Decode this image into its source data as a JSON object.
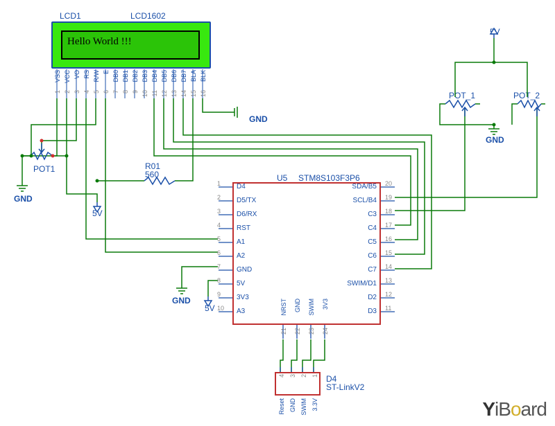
{
  "lcd": {
    "ref": "LCD1",
    "model": "LCD1602",
    "display_text": "Hello World !!!",
    "pins": [
      "VSS",
      "VCC",
      "VO",
      "RS",
      "R/W",
      "E",
      "DB0",
      "DB1",
      "DB2",
      "DB3",
      "DB4",
      "DB5",
      "DB6",
      "DB7",
      "BLA",
      "BLK"
    ],
    "pin_nums": [
      "1",
      "2",
      "3",
      "4",
      "5",
      "6",
      "7",
      "8",
      "9",
      "10",
      "11",
      "12",
      "13",
      "14",
      "15",
      "16"
    ]
  },
  "mcu": {
    "ref": "U5",
    "part": "STM8S103F3P6",
    "left_pins": [
      {
        "num": "1",
        "name": "D4"
      },
      {
        "num": "2",
        "name": "D5/TX"
      },
      {
        "num": "3",
        "name": "D6/RX"
      },
      {
        "num": "4",
        "name": "RST"
      },
      {
        "num": "5",
        "name": "A1"
      },
      {
        "num": "6",
        "name": "A2"
      },
      {
        "num": "7",
        "name": "GND"
      },
      {
        "num": "8",
        "name": "5V"
      },
      {
        "num": "9",
        "name": "3V3"
      },
      {
        "num": "10",
        "name": "A3"
      }
    ],
    "right_pins": [
      {
        "num": "20",
        "name": "SDA/B5"
      },
      {
        "num": "19",
        "name": "SCL/B4"
      },
      {
        "num": "18",
        "name": "C3"
      },
      {
        "num": "17",
        "name": "C4"
      },
      {
        "num": "16",
        "name": "C5"
      },
      {
        "num": "15",
        "name": "C6"
      },
      {
        "num": "14",
        "name": "C7"
      },
      {
        "num": "13",
        "name": "SWIM/D1"
      },
      {
        "num": "12",
        "name": "D2"
      },
      {
        "num": "11",
        "name": "D3"
      }
    ],
    "bottom_pins": [
      {
        "num": "21",
        "name": "NRST"
      },
      {
        "num": "22",
        "name": "GND"
      },
      {
        "num": "23",
        "name": "SWIM"
      },
      {
        "num": "24",
        "name": "3V3"
      }
    ]
  },
  "stlink": {
    "ref": "D4",
    "part": "ST-LinkV2",
    "pin_nums": [
      "4",
      "3",
      "2",
      "1"
    ],
    "labels": [
      "Reset",
      "GND",
      "SWIM",
      "3.3V"
    ]
  },
  "components": {
    "pot1": "POT1",
    "pot_r1": "POT_1",
    "pot_r2": "POT_2",
    "r01_ref": "R01",
    "r01_val": "560"
  },
  "nets": {
    "gnd": "GND",
    "v5": "5V"
  },
  "logo": {
    "text": "YiBoard"
  }
}
